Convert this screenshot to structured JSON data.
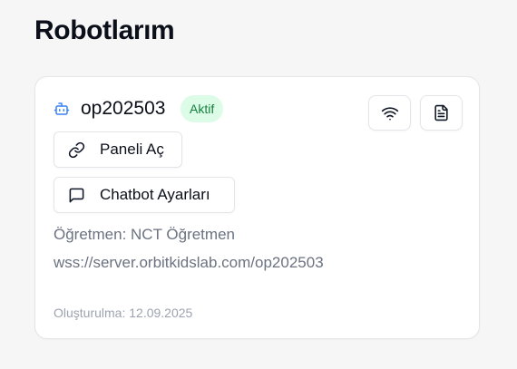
{
  "page": {
    "title": "Robotlarım"
  },
  "robot_card": {
    "name": "op202503",
    "status": "Aktif",
    "robot_icon": "robot-icon",
    "status_color": "#15803d",
    "status_bg": "#dcfce7",
    "icon_accent": "#3b82f6",
    "buttons": {
      "wifi_icon": "wifi-icon",
      "document_icon": "document-icon",
      "panel_label": "Paneli Aç",
      "panel_icon": "link-icon",
      "chatbot_label": "Chatbot Ayarları",
      "chatbot_icon": "message-square-icon"
    },
    "teacher": "Öğretmen: NCT Öğretmen",
    "ws_url": "wss://server.orbitkidslab.com/op202503",
    "created": "Oluşturulma: 12.09.2025"
  }
}
